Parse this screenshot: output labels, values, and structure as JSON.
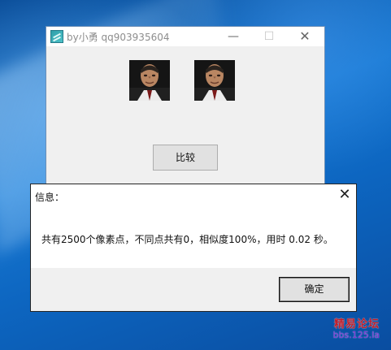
{
  "main_window": {
    "title": "by小勇 qq903935604",
    "minimize_symbol": "—",
    "maximize_symbol": "☐",
    "close_symbol": "✕",
    "compare_button": "比较"
  },
  "dialog": {
    "title": "信息：",
    "close_symbol": "✕",
    "message": "共有2500个像素点，不同点共有0，相似度100%，用时 0.02 秒。",
    "ok_button": "确定"
  },
  "watermark": {
    "main": "精易论坛",
    "sub": "bbs.125.la"
  },
  "icons": {
    "app_icon": "app-logo-icon",
    "minimize_icon": "minimize-icon",
    "maximize_icon": "maximize-icon",
    "close_icon": "close-icon"
  }
}
